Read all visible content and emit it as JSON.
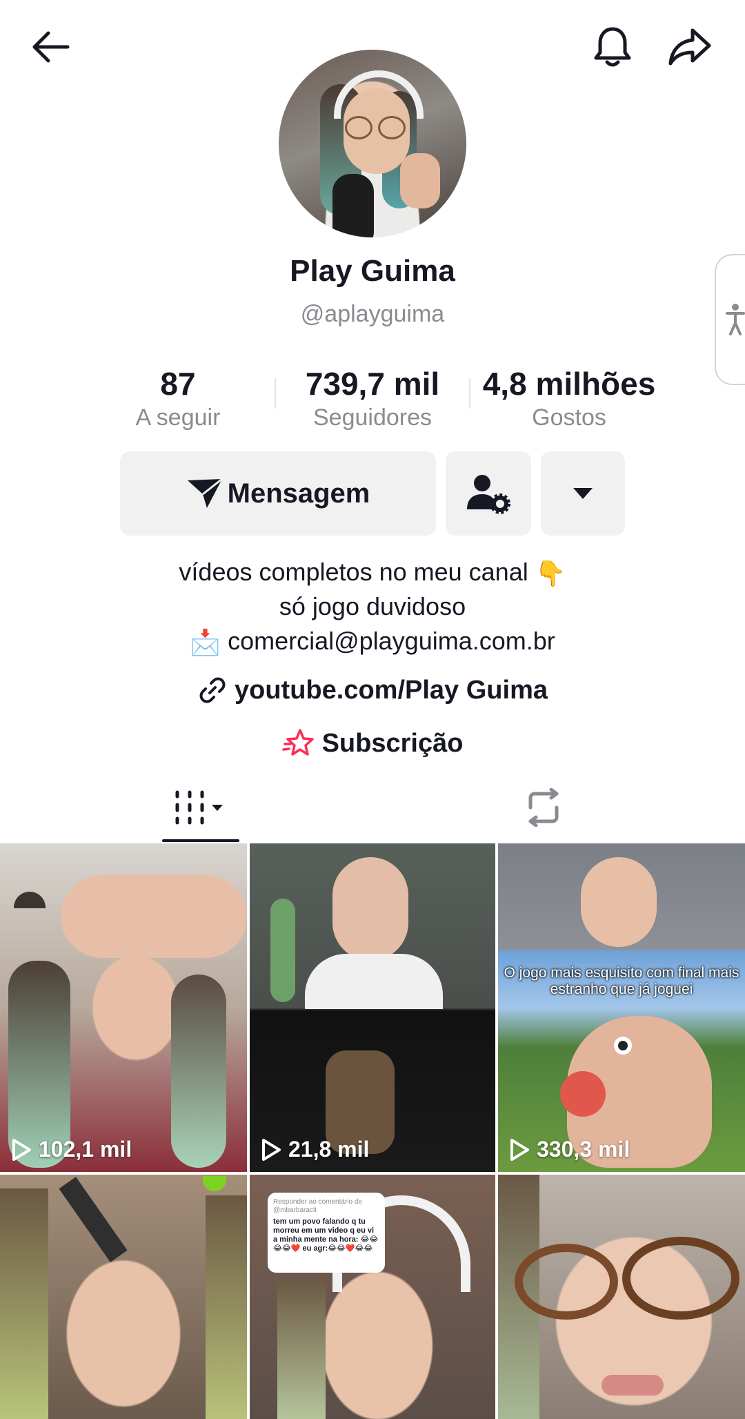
{
  "profile": {
    "name": "Play Guima",
    "handle": "@aplayguima"
  },
  "stats": {
    "following": {
      "value": "87",
      "label": "A seguir"
    },
    "followers": {
      "value": "739,7 mil",
      "label": "Seguidores"
    },
    "likes": {
      "value": "4,8 milhões",
      "label": "Gostos"
    }
  },
  "actions": {
    "message_label": "Mensagem"
  },
  "bio": {
    "line1": "vídeos completos no meu canal",
    "line1_emoji": "👇",
    "line2": "só jogo duvidoso",
    "line3": "comercial@playguima.com.br",
    "line3_emoji": "📩"
  },
  "link": {
    "text": "youtube.com/Play Guima"
  },
  "subscription": {
    "label": "Subscrição"
  },
  "videos": [
    {
      "views": "102,1 mil"
    },
    {
      "views": "21,8 mil"
    },
    {
      "views": "330,3 mil",
      "caption": "O jogo mais esquisito com final mais estranho que já joguei"
    },
    {
      "views": ""
    },
    {
      "views": "",
      "comment_header": "Responder ao comentário de @mbarbaracit",
      "comment_text": "tem um povo falando q tu morreu em um video q eu vi a minha mente na hora: 😂😂😂😂❤️ eu agr:😂😂❤️😂😂"
    },
    {
      "views": ""
    }
  ],
  "colors": {
    "text_primary": "#161823",
    "text_secondary": "#8a8b91",
    "button_bg": "#f1f1f2",
    "subscription_accent": "#fe2c55"
  },
  "icons": {
    "back": "arrow-left-icon",
    "bell": "bell-icon",
    "share": "share-arrow-icon",
    "message": "send-plane-icon",
    "add_friend": "user-gear-icon",
    "dropdown": "caret-down-icon",
    "link": "link-chain-icon",
    "subscription": "star-outline-icon",
    "grid_tab": "grid-columns-icon",
    "repost_tab": "repost-arrows-icon",
    "accessibility": "accessibility-person-icon",
    "play": "play-icon"
  }
}
